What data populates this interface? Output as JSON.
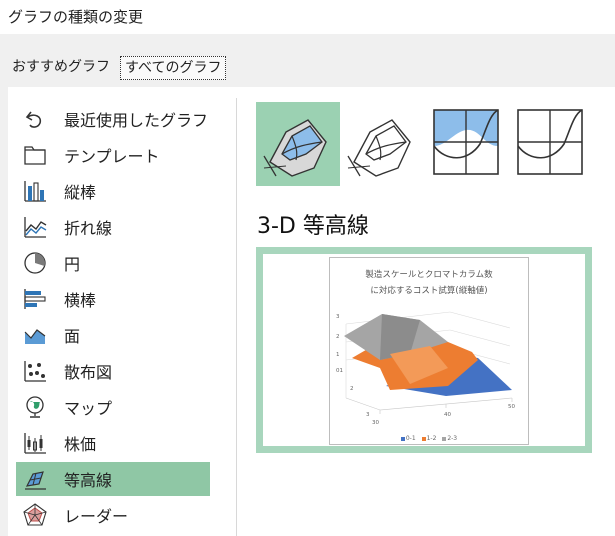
{
  "window": {
    "title": "グラフの種類の変更"
  },
  "tabs": [
    {
      "label": "おすすめグラフ"
    },
    {
      "label": "すべてのグラフ"
    }
  ],
  "nav": {
    "items": [
      {
        "label": "最近使用したグラフ",
        "icon": "recent-icon"
      },
      {
        "label": "テンプレート",
        "icon": "folder-icon"
      },
      {
        "label": "縦棒",
        "icon": "column-chart-icon"
      },
      {
        "label": "折れ線",
        "icon": "line-chart-icon"
      },
      {
        "label": "円",
        "icon": "pie-chart-icon"
      },
      {
        "label": "横棒",
        "icon": "bar-chart-icon"
      },
      {
        "label": "面",
        "icon": "area-chart-icon"
      },
      {
        "label": "散布図",
        "icon": "scatter-chart-icon"
      },
      {
        "label": "マップ",
        "icon": "map-chart-icon"
      },
      {
        "label": "株価",
        "icon": "stock-chart-icon"
      },
      {
        "label": "等高線",
        "icon": "surface-chart-icon",
        "selected": true
      },
      {
        "label": "レーダー",
        "icon": "radar-chart-icon"
      }
    ]
  },
  "subtypes": {
    "selected_title": "3-D 等高線",
    "items": [
      {
        "icon": "3d-surface-icon",
        "selected": true
      },
      {
        "icon": "3d-wireframe-surface-icon",
        "selected": false
      },
      {
        "icon": "contour-icon",
        "selected": false
      },
      {
        "icon": "wireframe-contour-icon",
        "selected": false
      }
    ]
  },
  "preview": {
    "title_line1": "製造スケールとクロマトカラム数",
    "title_line2": "に対応するコスト試算(縦軸値)",
    "colors": {
      "gray": "#a5a5a5",
      "orange": "#ed7d31",
      "blue": "#4472c4"
    },
    "legend": [
      {
        "label": "0-1",
        "color": "#4472c4"
      },
      {
        "label": "1-2",
        "color": "#ed7d31"
      },
      {
        "label": "2-3",
        "color": "#a5a5a5"
      }
    ],
    "z_ticks": [
      "3",
      "2",
      "1",
      "01",
      "2"
    ],
    "depth_ticks": [
      "3",
      "30"
    ],
    "x_ticks": [
      "40",
      "50"
    ]
  },
  "colors": {
    "accent": "#8fc7a5",
    "selected_thumb": "#9bd1b2",
    "preview_border": "#a8d6bd"
  }
}
